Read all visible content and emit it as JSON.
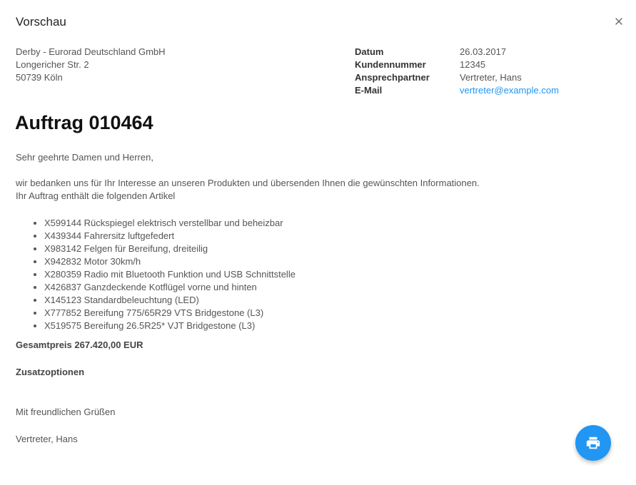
{
  "dialog": {
    "title": "Vorschau"
  },
  "address": {
    "line1": "Derby - Eurorad Deutschland GmbH",
    "line2": "Longericher Str. 2",
    "line3": "50739 Köln"
  },
  "meta": [
    {
      "label": "Datum",
      "value": "26.03.2017"
    },
    {
      "label": "Kundennummer",
      "value": "12345"
    },
    {
      "label": "Ansprechpartner",
      "value": "Vertreter, Hans"
    },
    {
      "label": "E-Mail",
      "value": "vertreter@example.com"
    }
  ],
  "order": {
    "title": "Auftrag 010464",
    "salutation": "Sehr geehrte Damen und Herren,",
    "intro_line1": "wir bedanken uns für Ihr Interesse an unseren Produkten und übersenden Ihnen die gewünschten Informationen.",
    "intro_line2": "Ihr Auftrag enthält die folgenden Artikel",
    "items": [
      "X599144 Rückspiegel elektrisch verstellbar und beheizbar",
      "X439344 Fahrersitz luftgefedert",
      "X983142 Felgen für Bereifung, dreiteilig",
      "X942832 Motor 30km/h",
      "X280359 Radio mit Bluetooth Funktion und USB Schnittstelle",
      "X426837 Ganzdeckende Kotflügel vorne und hinten",
      "X145123 Standardbeleuchtung (LED)",
      "X777852 Bereifung 775/65R29 VTS Bridgestone (L3)",
      "X519575 Bereifung 26.5R25* VJT Bridgestone (L3)"
    ],
    "total": "Gesamtpreis 267.420,00 EUR",
    "options_heading": "Zusatzoptionen",
    "closing": "Mit freundlichen Grüßen",
    "signature": "Vertreter, Hans"
  },
  "icons": {
    "close": "close-icon",
    "print": "print-icon"
  },
  "colors": {
    "accent": "#2196f3",
    "link": "#2196f3",
    "text": "#555555"
  }
}
